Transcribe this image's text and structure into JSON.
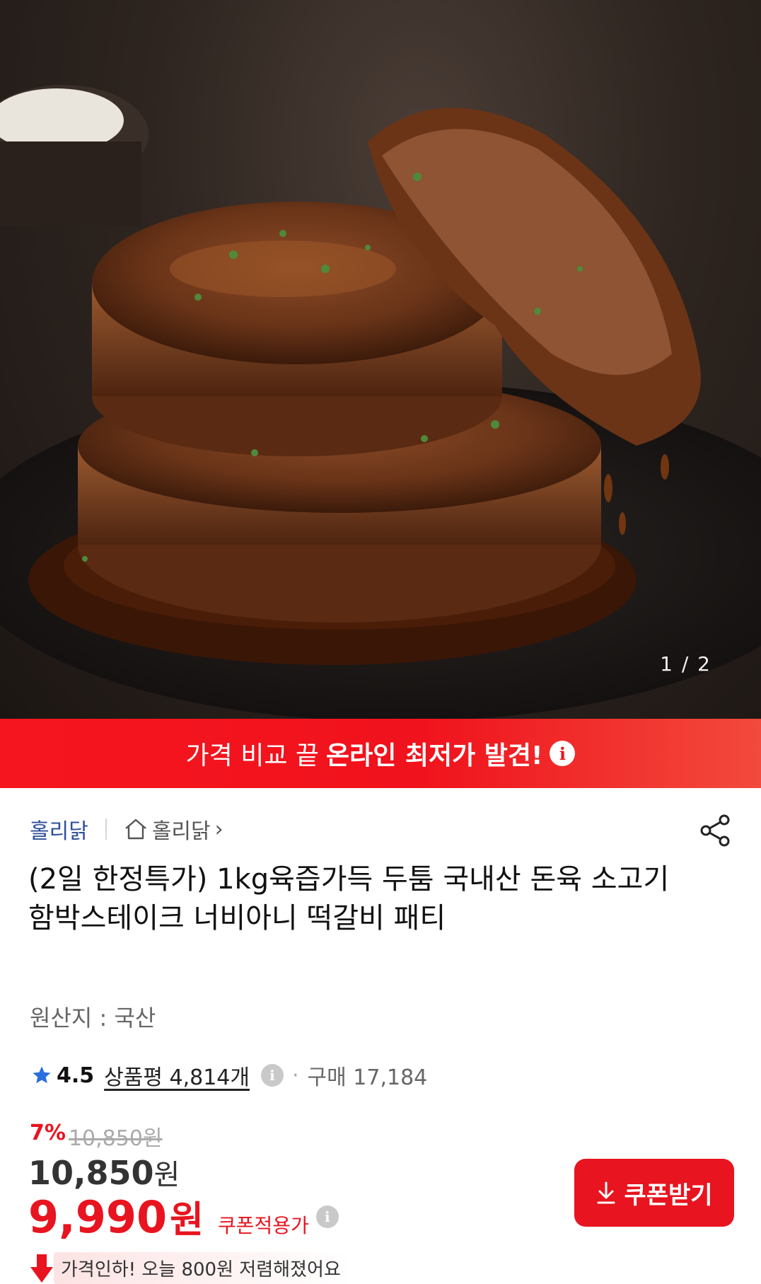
{
  "hero": {
    "counter": "1 / 2"
  },
  "banner": {
    "text_normal": "가격 비교 끝",
    "text_strong": "온라인 최저가 발견!",
    "info_icon": "info-icon"
  },
  "seller": {
    "brand": "홀리닭",
    "store": "홀리닭",
    "store_chevron": "›"
  },
  "product": {
    "title": "(2일 한정특가) 1kg육즙가득 두툼 국내산 돈육 소고기 함박스테이크 너비아니 떡갈비 패티",
    "origin": "원산지 : 국산"
  },
  "rating": {
    "score": "4.5",
    "reviews": "상품평 4,814개",
    "separator": "·",
    "purchases": "구매 17,184"
  },
  "pricing": {
    "discount_pct": "7%",
    "original": "10,850",
    "original_unit": "원",
    "price": "10,850",
    "price_unit": "원",
    "coupon_price": "9,990",
    "coupon_unit": "원",
    "coupon_label": "쿠폰적용가",
    "price_drop_note": "가격인하! 오늘 800원 저렴해졌어요"
  },
  "coupon_button": {
    "label": "쿠폰받기"
  },
  "colors": {
    "accent": "#e8141f",
    "brand_link": "#2f4f9a",
    "star": "#2b6ee0"
  }
}
